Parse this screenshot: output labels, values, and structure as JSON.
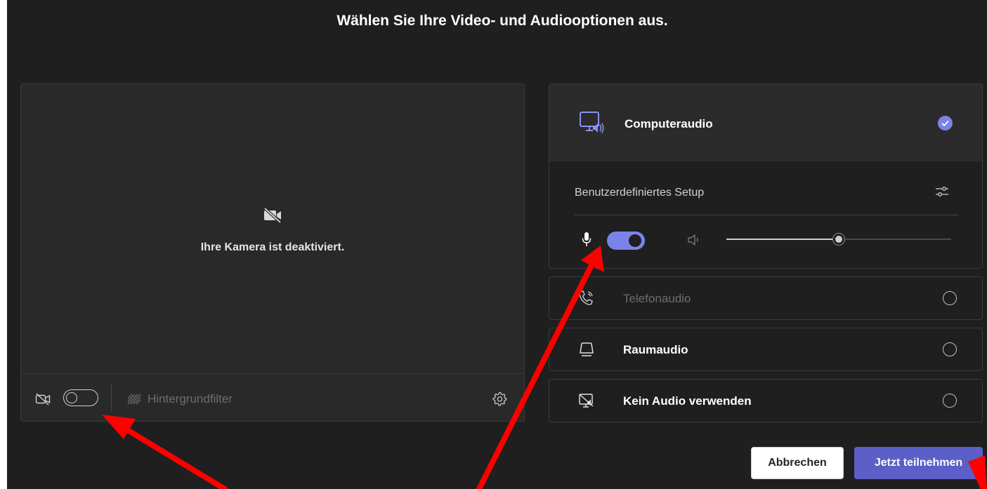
{
  "title": "Wählen Sie Ihre Video- und Audiooptionen aus.",
  "video": {
    "camera_off_icon": "camera-off-icon",
    "camera_off_text": "Ihre Kamera ist deaktiviert.",
    "toolbar": {
      "camera_toggle_state": "off",
      "background_filter_label": "Hintergrundfilter",
      "settings_icon": "gear-icon"
    }
  },
  "audio": {
    "computer_audio": {
      "label": "Computeraudio",
      "selected": true,
      "setup_label": "Benutzerdefiniertes Setup",
      "mic_toggle_state": "on",
      "speaker_volume": 0.5
    },
    "options": [
      {
        "label": "Telefonaudio",
        "icon": "phone-icon",
        "enabled": false
      },
      {
        "label": "Raumaudio",
        "icon": "room-audio-icon",
        "enabled": true
      },
      {
        "label": "Kein Audio verwenden",
        "icon": "no-audio-icon",
        "enabled": true
      }
    ]
  },
  "buttons": {
    "cancel": "Abbrechen",
    "join": "Jetzt teilnehmen"
  },
  "colors": {
    "background": "#1f1f1f",
    "accent": "#7b83eb",
    "join_button": "#5b5fc7",
    "annotation_arrow": "#ff0000"
  }
}
